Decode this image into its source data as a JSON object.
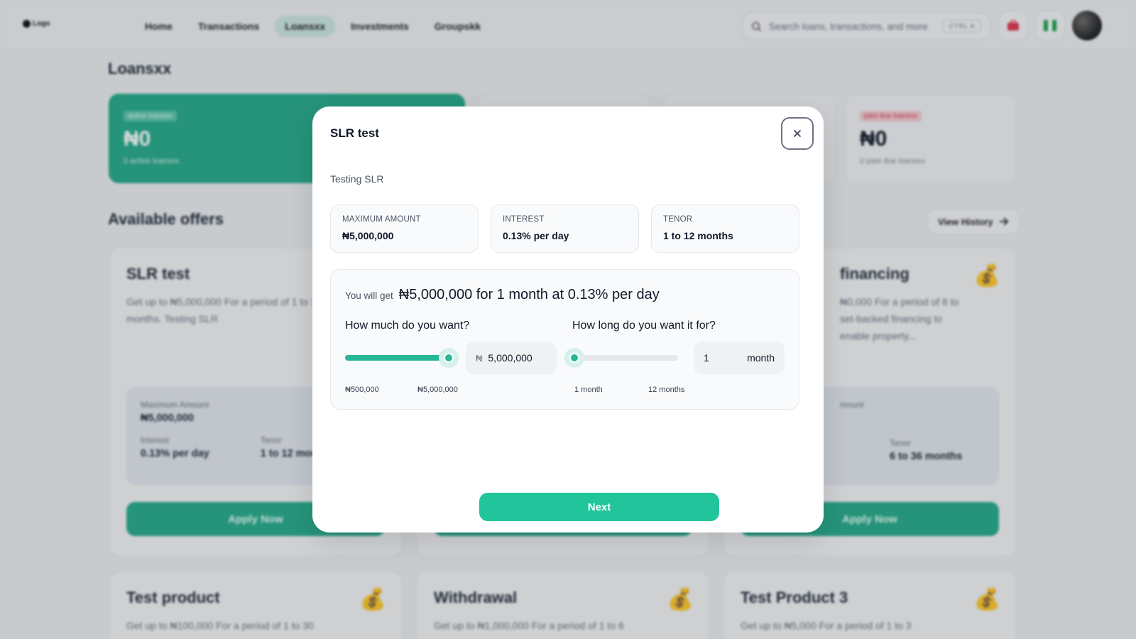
{
  "nav": {
    "logo": "Logo",
    "links": [
      "Home",
      "Transactions",
      "Loansxx",
      "Investments",
      "Groupskk"
    ],
    "search_placeholder": "Search loans, transactions, and more",
    "search_shortcut": "CTRL K"
  },
  "page": {
    "title": "Loansxx",
    "stats": [
      {
        "tag": "active loansxx",
        "amount": "₦0",
        "sub": "0 active loansxx"
      },
      {
        "tag": "past due loansxx",
        "amount": "₦0",
        "sub": "0 past due loansxx"
      }
    ],
    "offers_title": "Available offers",
    "view_history": "View History",
    "cards": [
      {
        "title": "SLR test",
        "desc": "Get up to ₦5,000,000 For a period of 1 to 12 months. Testing SLR",
        "max_label": "Maximum Amount",
        "max_value": "₦5,000,000",
        "interest_label": "Interest",
        "interest_value": "0.13% per day",
        "tenor_label": "Tenor",
        "tenor_value": "1 to 12 months",
        "apply": "Apply Now"
      },
      {
        "title": "financing",
        "desc": "₦0,000 For a period of 6 to set-backed financing to enable property...",
        "max_label": "mount",
        "tenor_label": "Tenor",
        "tenor_value": "6 to 36 months",
        "apply": "Apply Now"
      },
      {
        "title": "Test product",
        "desc": "Get up to ₦100,000 For a period of 1 to 30"
      },
      {
        "title": "Withdrawal",
        "desc": "Get up to ₦1,000,000 For a period of 1 to 6"
      },
      {
        "title": "Test Product 3",
        "desc": "Get up to ₦5,000 For a period of 1 to 3"
      }
    ]
  },
  "modal": {
    "title": "SLR test",
    "description": "Testing SLR",
    "stats": [
      {
        "label": "MAXIMUM AMOUNT",
        "value": "₦5,000,000"
      },
      {
        "label": "INTEREST",
        "value": "0.13% per day"
      },
      {
        "label": "TENOR",
        "value": "1 to 12 months"
      }
    ],
    "summary_prefix": "You will get",
    "summary": "₦5,000,000 for 1 month at 0.13% per day",
    "amount_question": "How much do you want?",
    "amount_currency": "₦",
    "amount_value": "5,000,000",
    "amount_min_label": "₦500,000",
    "amount_max_label": "₦5,000,000",
    "amount_fraction": 1.0,
    "tenor_question": "How long do you want it for?",
    "tenor_value": "1",
    "tenor_unit": "month",
    "tenor_min_label": "1 month",
    "tenor_max_label": "12 months",
    "tenor_fraction": 0.0,
    "next_label": "Next"
  },
  "colors": {
    "brand_green": "#21c49b",
    "card_green": "#26ab8a",
    "slider_green": "#26b896"
  }
}
